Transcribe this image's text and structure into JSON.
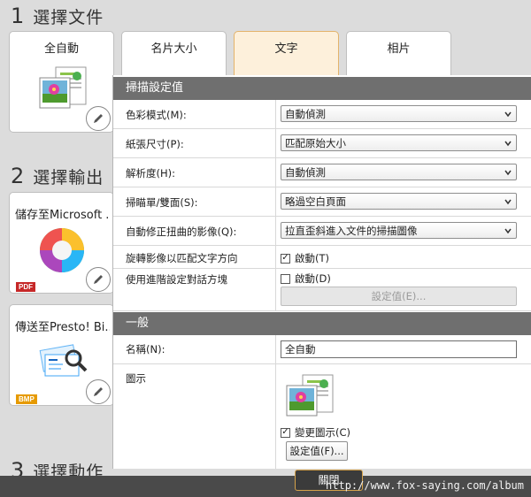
{
  "steps": {
    "step1": {
      "num": "1",
      "title": "選擇文件"
    },
    "step2": {
      "num": "2",
      "title": "選擇輸出"
    },
    "step3": {
      "num": "3",
      "title": "選擇動作"
    }
  },
  "doc_cards": [
    {
      "label": "全自動"
    },
    {
      "label": "名片大小"
    },
    {
      "label": "文字"
    },
    {
      "label": "相片"
    }
  ],
  "output_cards": [
    {
      "label": "儲存至Microsoft ...",
      "badge": "PDF",
      "badge_color": "#c62828"
    },
    {
      "label": "傳送至Presto! Bi...",
      "badge": "BMP",
      "badge_color": "#e69a00"
    }
  ],
  "scan_settings": {
    "header": "掃描設定值",
    "color_mode": {
      "label": "色彩模式(M):",
      "value": "自動偵測"
    },
    "paper_size": {
      "label": "紙張尺寸(P):",
      "value": "匹配原始大小"
    },
    "resolution": {
      "label": "解析度(H):",
      "value": "自動偵測"
    },
    "simplex_duplex": {
      "label": "掃瞄單/雙面(S):",
      "value": "略過空白頁面"
    },
    "deskew": {
      "label": "自動修正扭曲的影像(Q):",
      "value": "拉直歪斜進入文件的掃描圖像"
    },
    "rotate": {
      "label": "旋轉影像以匹配文字方向",
      "checkbox_label": "啟動(T)",
      "checked": true
    },
    "advanced": {
      "label": "使用進階設定對話方塊",
      "checkbox_label": "啟動(D)",
      "checked": false,
      "button": "設定值(E)..."
    }
  },
  "general": {
    "header": "一般",
    "name": {
      "label": "名稱(N):",
      "value": "全自動"
    },
    "icon": {
      "label": "圖示",
      "checkbox_label": "變更圖示(C)",
      "checked": true,
      "button": "設定值(F)..."
    }
  },
  "footer": {
    "close": "關閉",
    "watermark": "http://www.fox-saying.com/album"
  }
}
